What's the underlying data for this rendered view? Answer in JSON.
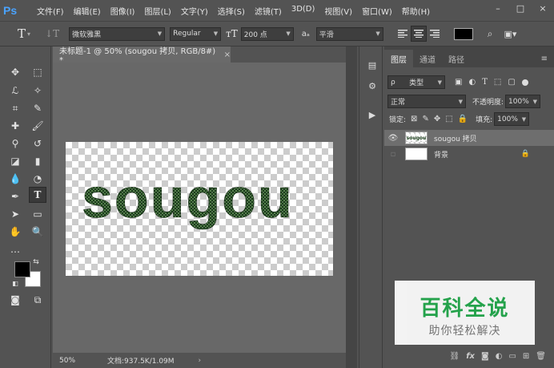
{
  "menubar": {
    "logo": "Ps",
    "items": [
      "文件(F)",
      "编辑(E)",
      "图像(I)",
      "图层(L)",
      "文字(Y)",
      "选择(S)",
      "滤镜(T)",
      "3D(D)",
      "视图(V)",
      "窗口(W)",
      "帮助(H)"
    ],
    "window_controls": [
      "–",
      "□",
      "×"
    ]
  },
  "options": {
    "font_family": "微软雅黑",
    "font_style": "Regular",
    "font_size": "200 点",
    "aa_label": "aₐ",
    "antialias": "平滑",
    "text_color": "#000000"
  },
  "document": {
    "tab_title": "未标题-1 @ 50% (sougou 拷贝, RGB/8#) *",
    "canvas_text": "sougou",
    "zoom": "50%",
    "doc_info": "文档:937.5K/1.09M"
  },
  "layers_panel": {
    "tabs": [
      "图层",
      "通道",
      "路径"
    ],
    "filter_kind": "类型",
    "blend_mode": "正常",
    "opacity_label": "不透明度:",
    "opacity_value": "100%",
    "lock_label": "锁定:",
    "fill_label": "填充:",
    "fill_value": "100%",
    "layers": [
      {
        "name": "sougou 拷贝",
        "visible": true,
        "selected": true
      },
      {
        "name": "背景",
        "visible": false,
        "selected": false
      }
    ],
    "footer_icons": [
      "link-icon",
      "fx-icon",
      "mask-icon",
      "adjustment-icon",
      "group-icon",
      "new-layer-icon",
      "trash-icon"
    ],
    "fx_label": "fx"
  },
  "watermark": {
    "title": "百科全说",
    "subtitle": "助你轻松解决"
  }
}
